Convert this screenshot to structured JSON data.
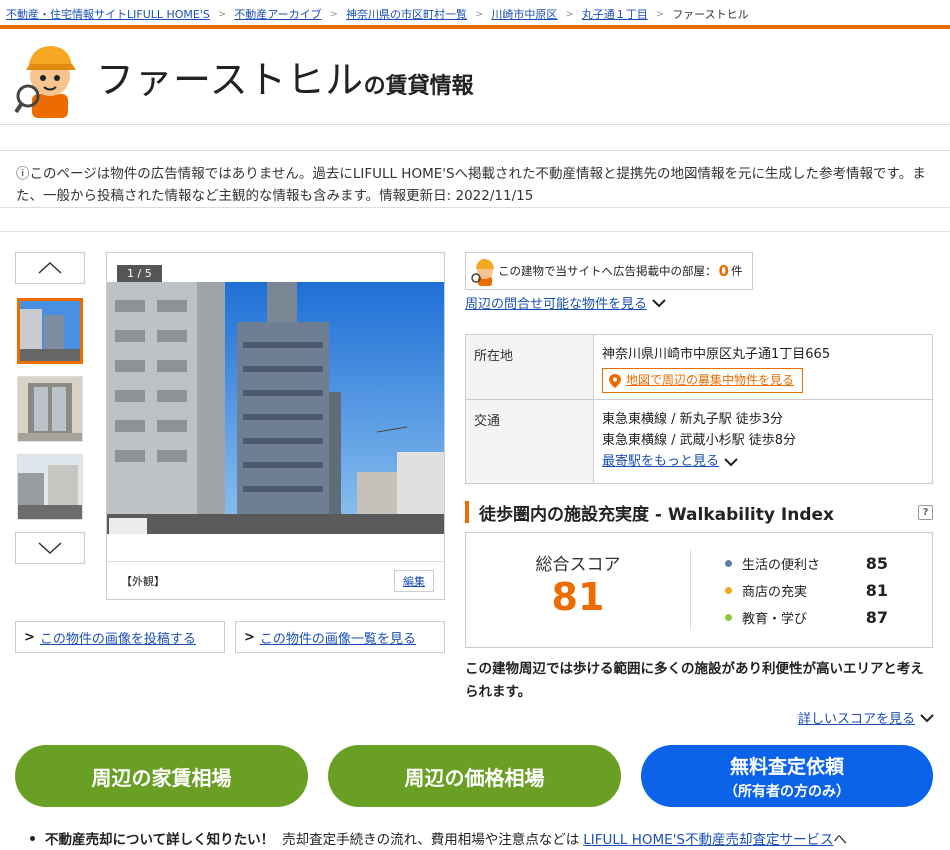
{
  "breadcrumb": {
    "items": [
      "不動産・住宅情報サイトLIFULL HOME'S",
      "不動産アーカイブ",
      "神奈川県の市区町村一覧",
      "川崎市中原区",
      "丸子通１丁目"
    ],
    "current": "ファーストヒル"
  },
  "header": {
    "title": "ファーストヒル",
    "title_suffix": "の賃貸情報"
  },
  "notice": {
    "text": "ⓘこのページは物件の広告情報ではありません。過去にLIFULL HOME'Sへ掲載された不動産情報と提携先の地図情報を元に生成した参考情報です。また、一般から投稿された情報など主観的な情報も含みます。情報更新日: 2022/11/15"
  },
  "gallery": {
    "counter": "1 / 5",
    "caption": "【外観】",
    "edit_label": "編集",
    "post_image_label": "この物件の画像を投稿する",
    "image_list_label": "この物件の画像一覧を見る"
  },
  "ad": {
    "text_before": "この建物で当サイトへ広告掲載中の部屋：",
    "count": "0",
    "unit": "件",
    "nearby_link": "周辺の問合せ可能な物件を見る"
  },
  "info": {
    "address_head": "所在地",
    "address": "神奈川県川崎市中原区丸子通1丁目665",
    "map_button": "地図で周辺の募集中物件を見る",
    "transport_head": "交通",
    "stations": [
      "東急東横線 / 新丸子駅 徒歩3分",
      "東急東横線 / 武蔵小杉駅 徒歩8分"
    ],
    "more_stations": "最寄駅をもっと見る"
  },
  "walkability": {
    "title": "徒歩圏内の施設充実度 - Walkability Index",
    "help": "?",
    "total_label": "総合スコア",
    "total_score": "81",
    "items": [
      {
        "label": "生活の便利さ",
        "value": "85",
        "color": "#5b7fa6"
      },
      {
        "label": "商店の充実",
        "value": "81",
        "color": "#f0a818"
      },
      {
        "label": "教育・学び",
        "value": "87",
        "color": "#8cc63f"
      }
    ],
    "description": "この建物周辺では歩ける範囲に多くの施設があり利便性が高いエリアと考えられます。",
    "detail_link": "詳しいスコアを見る"
  },
  "actions": {
    "rent_market": "周辺の家賃相場",
    "price_market": "周辺の価格相場",
    "assessment": "無料査定依頼",
    "assessment_sub": "（所有者の方のみ）"
  },
  "footer_note": {
    "bold": "不動産売却について詳しく知りたい！",
    "text": "売却査定手続きの流れ、費用相場や注意点などは",
    "link": "LIFULL HOME'S不動産売却査定サービス",
    "suffix": "へ"
  },
  "colors": {
    "accent": "#ed6c00",
    "green": "#69a023",
    "blue": "#0b63ea",
    "link": "#1a4fb4"
  }
}
